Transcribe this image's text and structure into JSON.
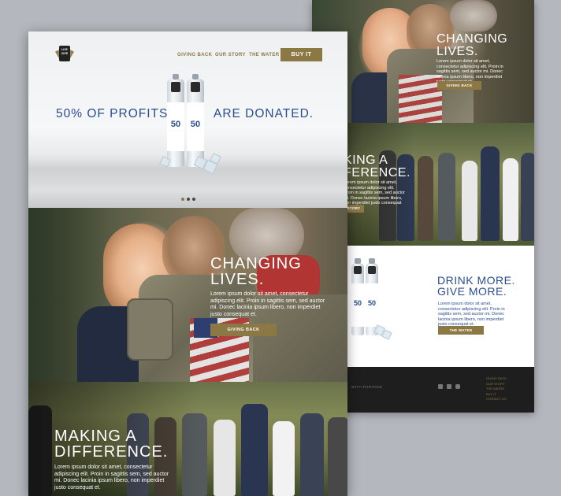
{
  "brand": {
    "logo_text": "LIVE GIVE"
  },
  "nav": {
    "links": [
      "GIVING BACK",
      "OUR STORY",
      "THE WATER"
    ],
    "buy_label": "BUY IT"
  },
  "hero": {
    "left_text": "50% OF PROFITS",
    "right_text": "ARE DONATED."
  },
  "bottle": {
    "percent": "50"
  },
  "sections": {
    "changing": {
      "title_line1": "CHANGING",
      "title_line2": "LIVES.",
      "body": "Lorem ipsum dolor sit amet, consectetur adipiscing elit. Proin in sagittis sem, sed auctor mi. Donec lacinia ipsum libero, non imperdiet justo consequat et.",
      "button": "GIVING BACK"
    },
    "difference": {
      "title_line1": "MAKING A",
      "title_line2": "DIFFERENCE.",
      "body": "Lorem ipsum dolor sit amet, consectetur adipiscing elit. Proin in sagittis sem, sed auctor mi. Donec lacinia ipsum libero, non imperdiet justo consequat et."
    },
    "drink": {
      "title_line1": "DRINK MORE.",
      "title_line2": "GIVE MORE.",
      "body": "Lorem ipsum dolor sit amet, consectetur adipiscing elit. Proin in sagittis sem, sed auctor mi. Donec lacinia ipsum libero, non imperdiet justo consequat et.",
      "button": "THE WATER"
    }
  },
  "back": {
    "difference_partial_line1": "KING A",
    "difference_partial_line2": "FERENCE.",
    "difference_button_partial": "STORY"
  },
  "footer": {
    "tagline": "WITH PURPOSE",
    "links": [
      "GIVING BACK",
      "OUR STORY",
      "THE WATER",
      "BUY IT",
      "CONTACT US"
    ],
    "social_icons": [
      "facebook-icon",
      "twitter-icon",
      "instagram-icon"
    ]
  },
  "carousel": {
    "count": 3,
    "active_index": 0
  },
  "colors": {
    "gold": "#8c7845",
    "blue": "#2a4d8f",
    "dark": "#1e1e1e"
  }
}
